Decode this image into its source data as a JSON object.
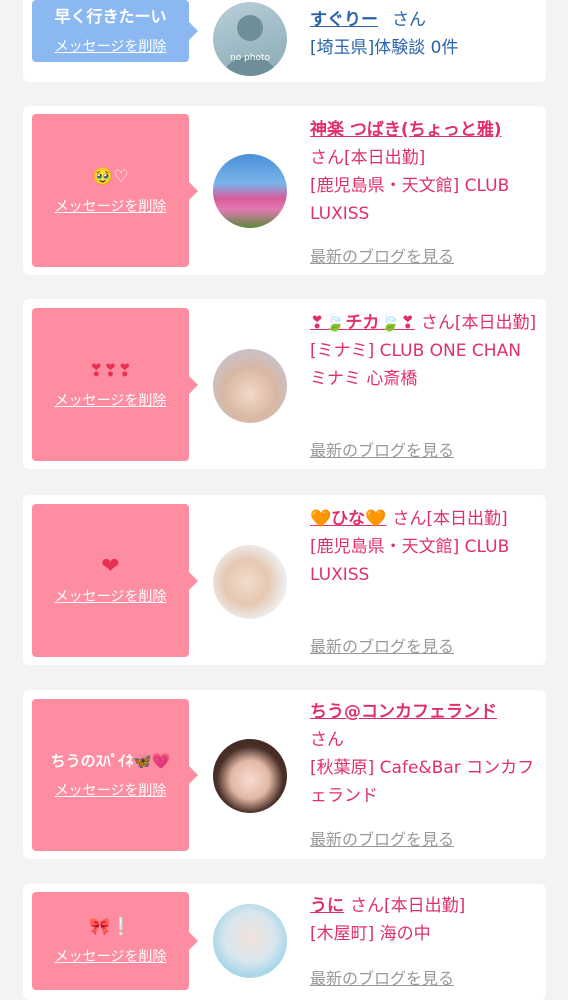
{
  "cards": [
    {
      "message": "早く行きたーい",
      "delete_label": "メッセージを削除",
      "name": "すぐりー",
      "suffix": "さん",
      "area": "[埼玉県]体験談 0件",
      "avatar": "no photo"
    },
    {
      "message": "🥹♡",
      "delete_label": "メッセージを削除",
      "name": "神楽 つばき(ちょっと雅)",
      "suffix": "さん[本日出勤]",
      "area": "[鹿児島県・天文館] CLUB LUXISS",
      "blog_label": "最新のブログを見る"
    },
    {
      "message": "❣❣❣",
      "delete_label": "メッセージを削除",
      "name": "❣🍃チカ🍃❣",
      "suffix": "さん[本日出勤]",
      "area": "[ミナミ] CLUB ONE CHAN ミナミ 心斎橋",
      "blog_label": "最新のブログを見る"
    },
    {
      "message": "❤",
      "delete_label": "メッセージを削除",
      "name": "🧡ひな🧡",
      "suffix": "さん[本日出勤]",
      "area": "[鹿児島県・天文館] CLUB LUXISS",
      "blog_label": "最新のブログを見る"
    },
    {
      "message": "ちうのｽﾊﾟｲﾈ🦋💗",
      "delete_label": "メッセージを削除",
      "name": "ちう@コンカフェランド",
      "suffix": "さん",
      "area": "[秋葉原] Cafe&Bar コンカフェランド",
      "blog_label": "最新のブログを見る"
    },
    {
      "message": "🎀❕",
      "delete_label": "メッセージを削除",
      "name": "うに",
      "suffix": "さん[本日出勤]",
      "area": "[木屋町] 海の中",
      "blog_label": "最新のブログを見る"
    }
  ]
}
